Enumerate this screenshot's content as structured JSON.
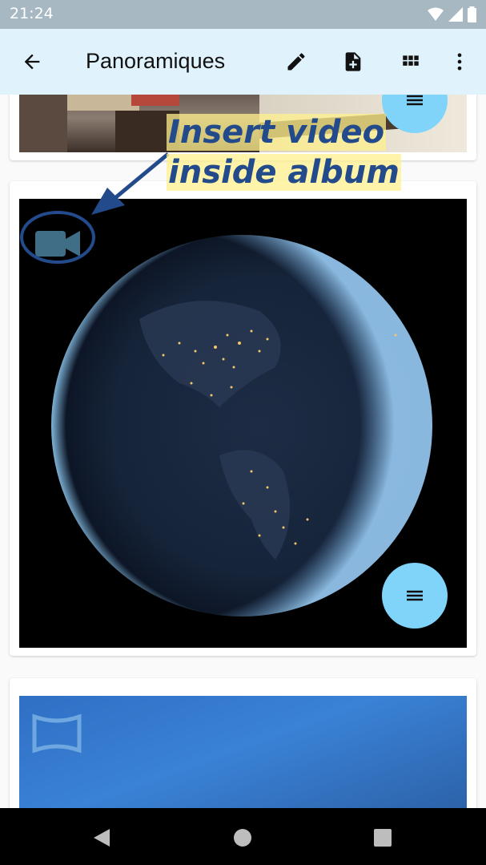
{
  "status_bar": {
    "time": "21:24",
    "icons": [
      "wifi-icon",
      "signal-icon",
      "battery-icon"
    ]
  },
  "app_bar": {
    "title": "Panoramiques",
    "actions": [
      "back-arrow-icon",
      "edit-pencil-icon",
      "add-file-icon",
      "grid-view-icon",
      "more-vert-icon"
    ]
  },
  "cards": [
    {
      "type": "photo",
      "fab_icon": "menu-icon"
    },
    {
      "type": "video",
      "badge_icon": "videocam-icon",
      "fab_icon": "menu-icon"
    },
    {
      "type": "panorama",
      "badge_icon": "panorama-icon"
    }
  ],
  "annotation": {
    "line1": "Insert video",
    "line2": "inside album"
  },
  "colors": {
    "app_bar": "#e0f3fd",
    "status_bar": "#a7b8c3",
    "fab": "#80d4fa",
    "annotation_text": "#234a8a",
    "annotation_highlight": "#fff08c"
  },
  "nav_bar": {
    "buttons": [
      "back-triangle-icon",
      "home-circle-icon",
      "recents-square-icon"
    ]
  }
}
